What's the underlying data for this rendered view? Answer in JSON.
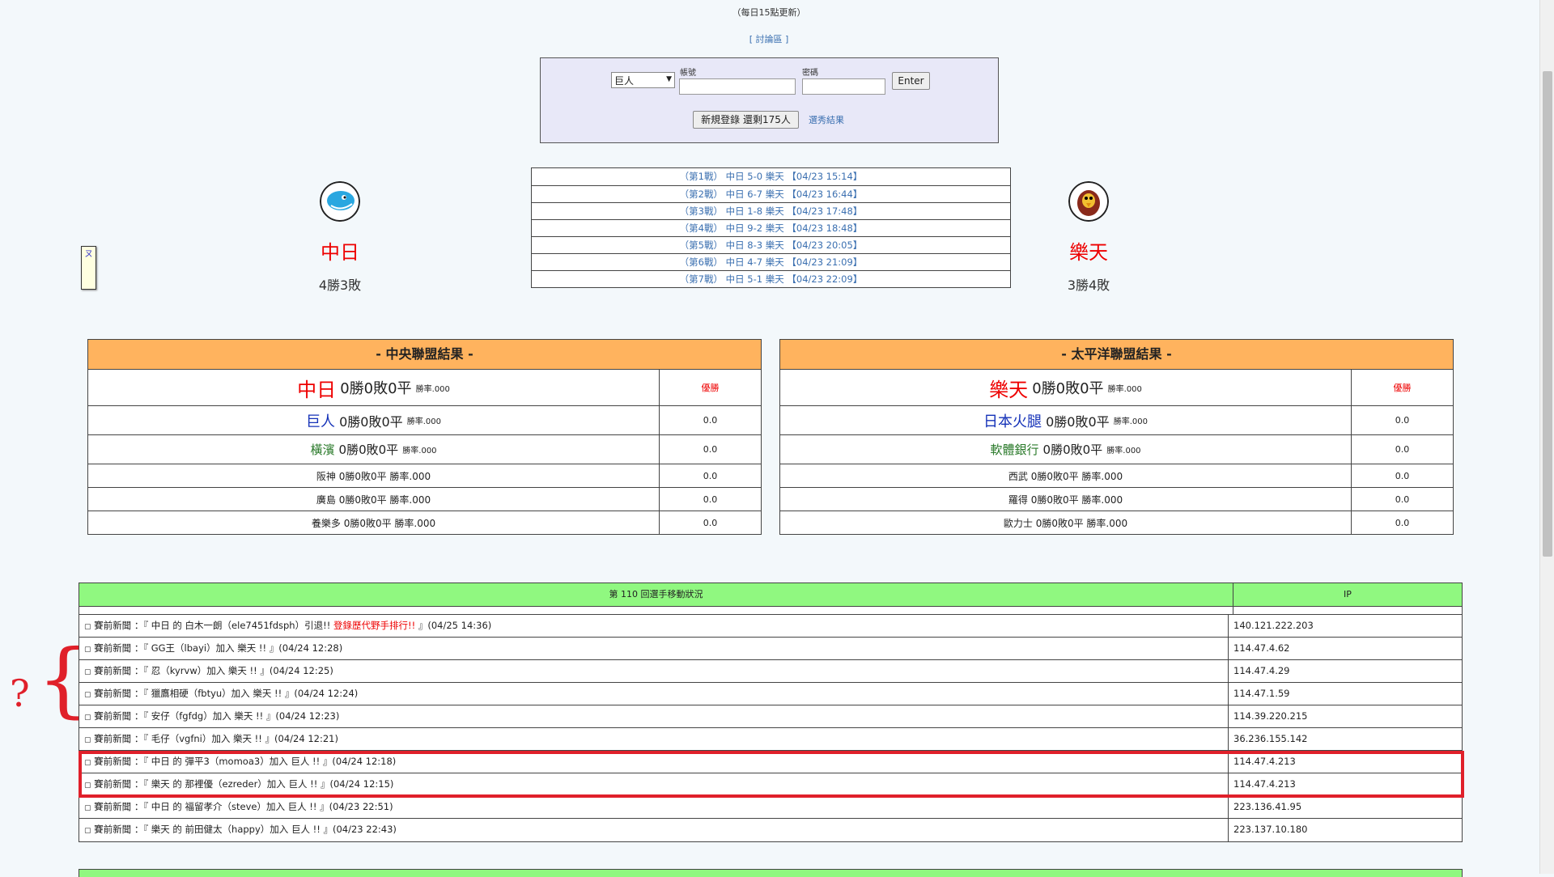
{
  "header": {
    "update_note": "（每日15點更新）",
    "forum_link": "[ 討論區 ]"
  },
  "login": {
    "team_select_value": "巨人",
    "account_label": "帳號",
    "password_label": "密碼",
    "enter_label": "Enter",
    "register_label": "新規登錄 還剩175人",
    "results_link": "選秀結果"
  },
  "matchup": {
    "left_team": {
      "name": "中日",
      "record": "4勝3敗",
      "logo": "dragon-mascot-icon"
    },
    "right_team": {
      "name": "樂天",
      "record": "3勝4敗",
      "logo": "eagle-mascot-icon"
    },
    "games": [
      "（第1戰） 中日 5-0 樂天 【04/23 15:14】",
      "（第2戰） 中日 6-7 樂天 【04/23 16:44】",
      "（第3戰） 中日 1-8 樂天 【04/23 17:48】",
      "（第4戰） 中日 9-2 樂天 【04/23 18:48】",
      "（第5戰） 中日 8-3 樂天 【04/23 20:05】",
      "（第6戰） 中日 4-7 樂天 【04/23 21:09】",
      "（第7戰） 中日 5-1 樂天 【04/23 22:09】"
    ],
    "side_widget_text": "ㄡ"
  },
  "central_league": {
    "title": "- 中央聯盟結果 -",
    "rows": [
      {
        "team": "中日",
        "stats": "0勝0敗0平",
        "rate": "勝率.000",
        "value": "優勝"
      },
      {
        "team": "巨人",
        "stats": "0勝0敗0平",
        "rate": "勝率.000",
        "value": "0.0"
      },
      {
        "team": "橫濱",
        "stats": "0勝0敗0平",
        "rate": "勝率.000",
        "value": "0.0"
      },
      {
        "team": "阪神",
        "stats": "0勝0敗0平",
        "rate": "勝率.000",
        "value": "0.0"
      },
      {
        "team": "廣島",
        "stats": "0勝0敗0平",
        "rate": "勝率.000",
        "value": "0.0"
      },
      {
        "team": "養樂多",
        "stats": "0勝0敗0平",
        "rate": "勝率.000",
        "value": "0.0"
      }
    ]
  },
  "pacific_league": {
    "title": "- 太平洋聯盟結果 -",
    "rows": [
      {
        "team": "樂天",
        "stats": "0勝0敗0平",
        "rate": "勝率.000",
        "value": "優勝"
      },
      {
        "team": "日本火腿",
        "stats": "0勝0敗0平",
        "rate": "勝率.000",
        "value": "0.0"
      },
      {
        "team": "軟體銀行",
        "stats": "0勝0敗0平",
        "rate": "勝率.000",
        "value": "0.0"
      },
      {
        "team": "西武",
        "stats": "0勝0敗0平",
        "rate": "勝率.000",
        "value": "0.0"
      },
      {
        "team": "羅得",
        "stats": "0勝0敗0平",
        "rate": "勝率.000",
        "value": "0.0"
      },
      {
        "team": "歐力士",
        "stats": "0勝0敗0平",
        "rate": "勝率.000",
        "value": "0.0"
      }
    ]
  },
  "news": {
    "header": "第 110 回選手移動狀況",
    "ip_header": "IP",
    "rows": [
      {
        "text": "賽前新聞 ：『 中日 的 白木一朗（ele7451fdsph）引退!! ",
        "highlight": "登錄歷代野手排行!!",
        "tail": " 』(04/25 14:36)",
        "ip": "140.121.222.203"
      },
      {
        "text": "賽前新聞 ：『 GG王（lbayi）加入 樂天 !! 』(04/24 12:28)",
        "ip": "114.47.4.62"
      },
      {
        "text": "賽前新聞 ：『 忍（kyrvw）加入 樂天 !! 』(04/24 12:25)",
        "ip": "114.47.4.29"
      },
      {
        "text": "賽前新聞 ：『 獵鷹相硬（fbtyu）加入 樂天 !! 』(04/24 12:24)",
        "ip": "114.47.1.59"
      },
      {
        "text": "賽前新聞 ：『 安仔（fgfdg）加入 樂天 !! 』(04/24 12:23)",
        "ip": "114.39.220.215"
      },
      {
        "text": "賽前新聞 ：『 毛仔（vgfni）加入 樂天 !! 』(04/24 12:21)",
        "ip": "36.236.155.142"
      },
      {
        "text": "賽前新聞 ：『 中日 的 彈平3（momoa3）加入 巨人 !! 』(04/24 12:18)",
        "ip": "114.47.4.213"
      },
      {
        "text": "賽前新聞 ：『 樂天 的 那裡優（ezreder）加入 巨人 !! 』(04/24 12:15)",
        "ip": "114.47.4.213"
      },
      {
        "text": "賽前新聞 ：『 中日 的 福留孝介（steve）加入 巨人 !! 』(04/23 22:51)",
        "ip": "223.136.41.95"
      },
      {
        "text": "賽前新聞 ：『 樂天 的 前田健太（happy）加入 巨人 !! 』(04/23 22:43)",
        "ip": "223.137.10.180"
      }
    ]
  },
  "annotation": {
    "question_mark": "?",
    "brace": "{"
  },
  "colors": {
    "league_header": "#ffb35e",
    "news_header": "#90f880",
    "highlight_box": "#e0202a",
    "link": "#3a6fb0"
  }
}
